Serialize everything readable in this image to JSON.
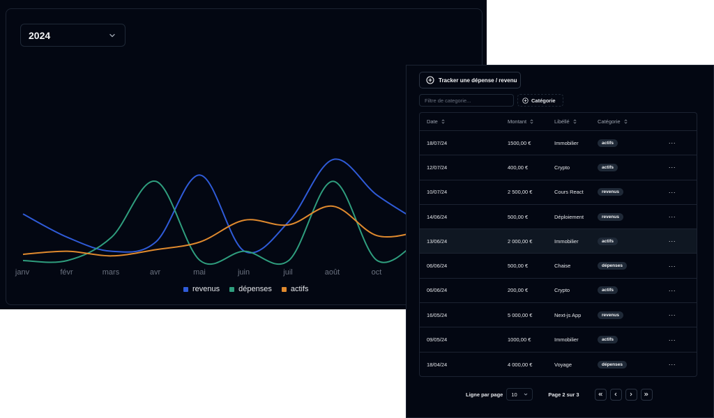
{
  "year_select": {
    "value": "2024"
  },
  "chart_data": {
    "type": "line",
    "categories": [
      "janv",
      "févr",
      "mars",
      "avr",
      "mai",
      "juin",
      "juil",
      "août",
      "oct"
    ],
    "series": [
      {
        "name": "revenus",
        "color": "#2f5bd8",
        "values": [
          6,
          4.5,
          3.6,
          4.2,
          8.5,
          3.6,
          5.5,
          9.5,
          7.2,
          5.4
        ]
      },
      {
        "name": "dépenses",
        "color": "#2f9e7e",
        "values": [
          3,
          3,
          4.5,
          8.1,
          3.0,
          3.6,
          3.0,
          8.1,
          3.0,
          4.5
        ]
      },
      {
        "name": "actifs",
        "color": "#e08a2e",
        "values": [
          3.4,
          3.6,
          3.3,
          3.7,
          4.2,
          5.6,
          5.3,
          6.5,
          4.6,
          4.9
        ]
      }
    ]
  },
  "table_panel": {
    "track_button": "Tracker une dépense / revenu",
    "filter_placeholder": "Filtre de categorie...",
    "category_button": "Catégorie",
    "columns": {
      "date": "Date",
      "amount": "Montant",
      "label": "Libéllé",
      "category": "Catégorie"
    },
    "rows": [
      {
        "date": "18/07/24",
        "amount": "1500,00 €",
        "label": "Immobilier",
        "category": "actifs"
      },
      {
        "date": "12/07/24",
        "amount": "400,00 €",
        "label": "Crypto",
        "category": "actifs"
      },
      {
        "date": "10/07/24",
        "amount": "2 500,00 €",
        "label": "Cours React",
        "category": "revenus"
      },
      {
        "date": "14/06/24",
        "amount": "500,00 €",
        "label": "Déploiement",
        "category": "revenus"
      },
      {
        "date": "13/06/24",
        "amount": "2 000,00 €",
        "label": "Immobilier",
        "category": "actifs"
      },
      {
        "date": "06/06/24",
        "amount": "500,00 €",
        "label": "Chaise",
        "category": "dépenses"
      },
      {
        "date": "06/06/24",
        "amount": "200,00 €",
        "label": "Crypto",
        "category": "actifs"
      },
      {
        "date": "16/05/24",
        "amount": "5 000,00 €",
        "label": "Next-js App",
        "category": "revenus"
      },
      {
        "date": "09/05/24",
        "amount": "1000,00 €",
        "label": "Immobilier",
        "category": "actifs"
      },
      {
        "date": "18/04/24",
        "amount": "4 000,00 €",
        "label": "Voyage",
        "category": "dépenses"
      }
    ],
    "row_menu": "···",
    "pagination": {
      "rows_label": "Ligne par page",
      "rows_value": "10",
      "page_info": "Page 2 sur 3"
    }
  }
}
